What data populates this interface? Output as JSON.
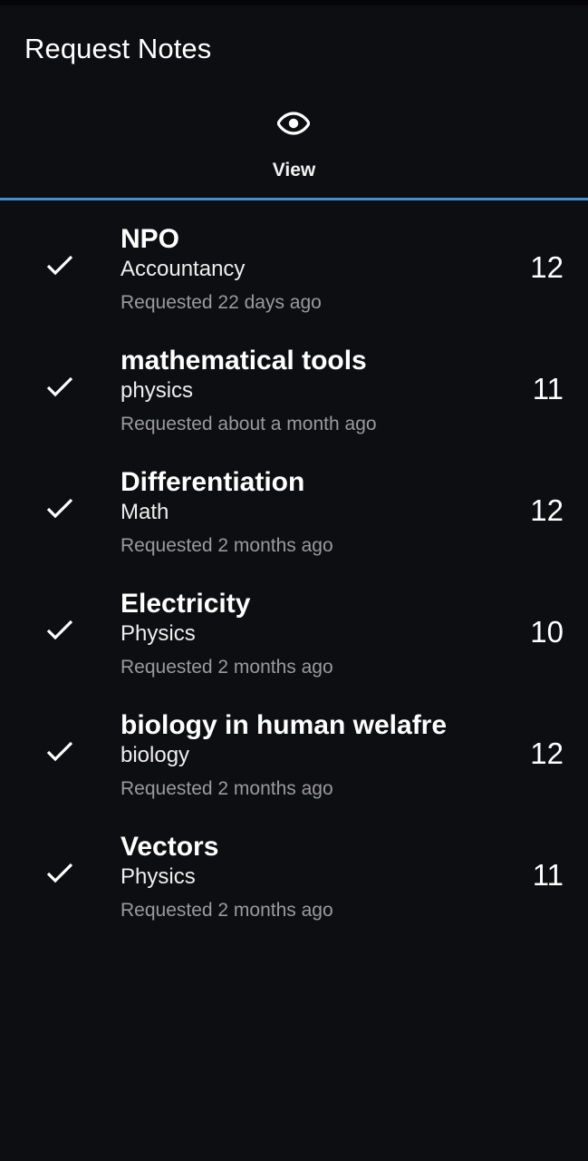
{
  "app_bar": {
    "title": "Request Notes"
  },
  "tabs": [
    {
      "label": "View",
      "icon": "eye-icon",
      "selected": true
    }
  ],
  "colors": {
    "background": "#0d0e12",
    "accent": "#3d8ed8",
    "secondary_text": "#9a9a9e"
  },
  "requests": [
    {
      "title": "NPO",
      "subject": "Accountancy",
      "time": "Requested 22 days ago",
      "count": "12",
      "status_icon": "check-icon"
    },
    {
      "title": "mathematical tools",
      "subject": "physics",
      "time": "Requested about a month ago",
      "count": "11",
      "status_icon": "check-icon"
    },
    {
      "title": "Differentiation",
      "subject": "Math",
      "time": "Requested 2 months ago",
      "count": "12",
      "status_icon": "check-icon"
    },
    {
      "title": "Electricity",
      "subject": "Physics",
      "time": "Requested 2 months ago",
      "count": "10",
      "status_icon": "check-icon"
    },
    {
      "title": "biology in human welafre",
      "subject": "biology",
      "time": "Requested 2 months ago",
      "count": "12",
      "status_icon": "check-icon"
    },
    {
      "title": "Vectors",
      "subject": "Physics",
      "time": "Requested 2 months ago",
      "count": "11",
      "status_icon": "check-icon"
    }
  ]
}
